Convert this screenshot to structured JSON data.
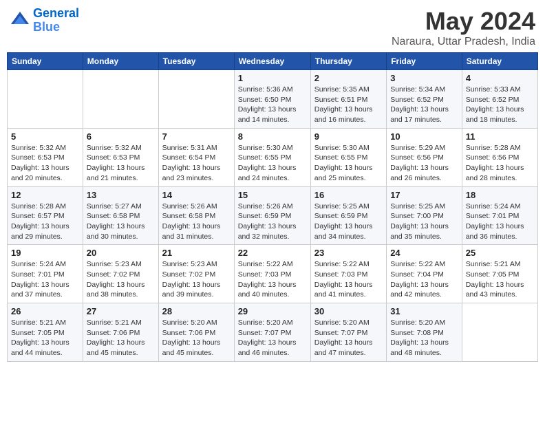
{
  "header": {
    "logo_line1": "General",
    "logo_line2": "Blue",
    "title": "May 2024",
    "subtitle": "Naraura, Uttar Pradesh, India"
  },
  "days_of_week": [
    "Sunday",
    "Monday",
    "Tuesday",
    "Wednesday",
    "Thursday",
    "Friday",
    "Saturday"
  ],
  "weeks": [
    [
      {
        "num": "",
        "info": ""
      },
      {
        "num": "",
        "info": ""
      },
      {
        "num": "",
        "info": ""
      },
      {
        "num": "1",
        "info": "Sunrise: 5:36 AM\nSunset: 6:50 PM\nDaylight: 13 hours\nand 14 minutes."
      },
      {
        "num": "2",
        "info": "Sunrise: 5:35 AM\nSunset: 6:51 PM\nDaylight: 13 hours\nand 16 minutes."
      },
      {
        "num": "3",
        "info": "Sunrise: 5:34 AM\nSunset: 6:52 PM\nDaylight: 13 hours\nand 17 minutes."
      },
      {
        "num": "4",
        "info": "Sunrise: 5:33 AM\nSunset: 6:52 PM\nDaylight: 13 hours\nand 18 minutes."
      }
    ],
    [
      {
        "num": "5",
        "info": "Sunrise: 5:32 AM\nSunset: 6:53 PM\nDaylight: 13 hours\nand 20 minutes."
      },
      {
        "num": "6",
        "info": "Sunrise: 5:32 AM\nSunset: 6:53 PM\nDaylight: 13 hours\nand 21 minutes."
      },
      {
        "num": "7",
        "info": "Sunrise: 5:31 AM\nSunset: 6:54 PM\nDaylight: 13 hours\nand 23 minutes."
      },
      {
        "num": "8",
        "info": "Sunrise: 5:30 AM\nSunset: 6:55 PM\nDaylight: 13 hours\nand 24 minutes."
      },
      {
        "num": "9",
        "info": "Sunrise: 5:30 AM\nSunset: 6:55 PM\nDaylight: 13 hours\nand 25 minutes."
      },
      {
        "num": "10",
        "info": "Sunrise: 5:29 AM\nSunset: 6:56 PM\nDaylight: 13 hours\nand 26 minutes."
      },
      {
        "num": "11",
        "info": "Sunrise: 5:28 AM\nSunset: 6:56 PM\nDaylight: 13 hours\nand 28 minutes."
      }
    ],
    [
      {
        "num": "12",
        "info": "Sunrise: 5:28 AM\nSunset: 6:57 PM\nDaylight: 13 hours\nand 29 minutes."
      },
      {
        "num": "13",
        "info": "Sunrise: 5:27 AM\nSunset: 6:58 PM\nDaylight: 13 hours\nand 30 minutes."
      },
      {
        "num": "14",
        "info": "Sunrise: 5:26 AM\nSunset: 6:58 PM\nDaylight: 13 hours\nand 31 minutes."
      },
      {
        "num": "15",
        "info": "Sunrise: 5:26 AM\nSunset: 6:59 PM\nDaylight: 13 hours\nand 32 minutes."
      },
      {
        "num": "16",
        "info": "Sunrise: 5:25 AM\nSunset: 6:59 PM\nDaylight: 13 hours\nand 34 minutes."
      },
      {
        "num": "17",
        "info": "Sunrise: 5:25 AM\nSunset: 7:00 PM\nDaylight: 13 hours\nand 35 minutes."
      },
      {
        "num": "18",
        "info": "Sunrise: 5:24 AM\nSunset: 7:01 PM\nDaylight: 13 hours\nand 36 minutes."
      }
    ],
    [
      {
        "num": "19",
        "info": "Sunrise: 5:24 AM\nSunset: 7:01 PM\nDaylight: 13 hours\nand 37 minutes."
      },
      {
        "num": "20",
        "info": "Sunrise: 5:23 AM\nSunset: 7:02 PM\nDaylight: 13 hours\nand 38 minutes."
      },
      {
        "num": "21",
        "info": "Sunrise: 5:23 AM\nSunset: 7:02 PM\nDaylight: 13 hours\nand 39 minutes."
      },
      {
        "num": "22",
        "info": "Sunrise: 5:22 AM\nSunset: 7:03 PM\nDaylight: 13 hours\nand 40 minutes."
      },
      {
        "num": "23",
        "info": "Sunrise: 5:22 AM\nSunset: 7:03 PM\nDaylight: 13 hours\nand 41 minutes."
      },
      {
        "num": "24",
        "info": "Sunrise: 5:22 AM\nSunset: 7:04 PM\nDaylight: 13 hours\nand 42 minutes."
      },
      {
        "num": "25",
        "info": "Sunrise: 5:21 AM\nSunset: 7:05 PM\nDaylight: 13 hours\nand 43 minutes."
      }
    ],
    [
      {
        "num": "26",
        "info": "Sunrise: 5:21 AM\nSunset: 7:05 PM\nDaylight: 13 hours\nand 44 minutes."
      },
      {
        "num": "27",
        "info": "Sunrise: 5:21 AM\nSunset: 7:06 PM\nDaylight: 13 hours\nand 45 minutes."
      },
      {
        "num": "28",
        "info": "Sunrise: 5:20 AM\nSunset: 7:06 PM\nDaylight: 13 hours\nand 45 minutes."
      },
      {
        "num": "29",
        "info": "Sunrise: 5:20 AM\nSunset: 7:07 PM\nDaylight: 13 hours\nand 46 minutes."
      },
      {
        "num": "30",
        "info": "Sunrise: 5:20 AM\nSunset: 7:07 PM\nDaylight: 13 hours\nand 47 minutes."
      },
      {
        "num": "31",
        "info": "Sunrise: 5:20 AM\nSunset: 7:08 PM\nDaylight: 13 hours\nand 48 minutes."
      },
      {
        "num": "",
        "info": ""
      }
    ]
  ]
}
